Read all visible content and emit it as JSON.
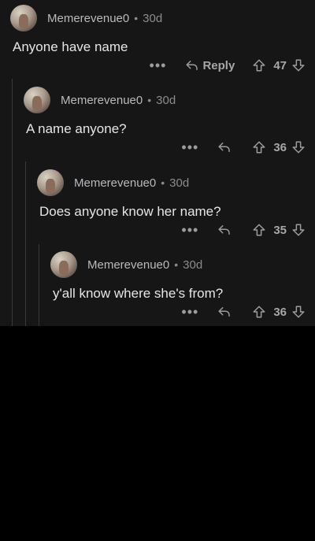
{
  "comments": [
    {
      "username": "Memerevenue0",
      "age": "30d",
      "text": "Anyone have name",
      "reply_label": "Reply",
      "score": "47"
    },
    {
      "username": "Memerevenue0",
      "age": "30d",
      "text": "A name anyone?",
      "reply_label": "",
      "score": "36"
    },
    {
      "username": "Memerevenue0",
      "age": "30d",
      "text": "Does anyone know her name?",
      "reply_label": "",
      "score": "35"
    },
    {
      "username": "Memerevenue0",
      "age": "30d",
      "text": "y'all know where she's from?",
      "reply_label": "",
      "score": "36"
    }
  ],
  "separator": "•",
  "more_label": "•••",
  "icons": {
    "reply": "reply-arrow-icon",
    "upvote": "upvote-arrow-icon",
    "downvote": "downvote-arrow-icon"
  },
  "colors": {
    "background": "#000000",
    "thread_background": "#161616",
    "text": "#e5e6e7",
    "muted": "#8a8c8f"
  }
}
